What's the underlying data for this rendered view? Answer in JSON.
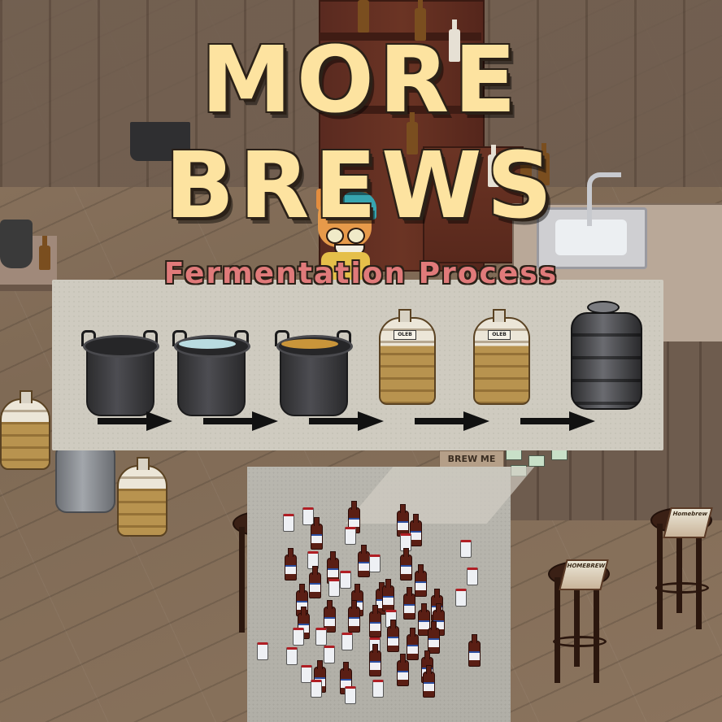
{
  "title": "MORE BREWS",
  "subtitle": "Fermentation Process",
  "colors": {
    "title": "#fde3a0",
    "subtitle": "#e07a7a",
    "outline": "#2b2118",
    "panel": "#cfcbc0"
  },
  "process": {
    "stages": [
      {
        "name": "empty-pot",
        "fill": ""
      },
      {
        "name": "water-pot",
        "fill": "#b9dbe0"
      },
      {
        "name": "wort-pot",
        "fill": "#c9953a"
      },
      {
        "name": "carboy",
        "fill": ""
      },
      {
        "name": "carboy",
        "fill": ""
      },
      {
        "name": "keg",
        "fill": ""
      }
    ],
    "carboy_label": "OLEB"
  },
  "scene": {
    "brew_me_label": "BREW ME",
    "magazine_label": "HOMEBREW",
    "poster_label": "Homebrew"
  },
  "loot": {
    "bottle_icon": "beer-bottle-icon",
    "can_icon": "beer-can-icon"
  }
}
